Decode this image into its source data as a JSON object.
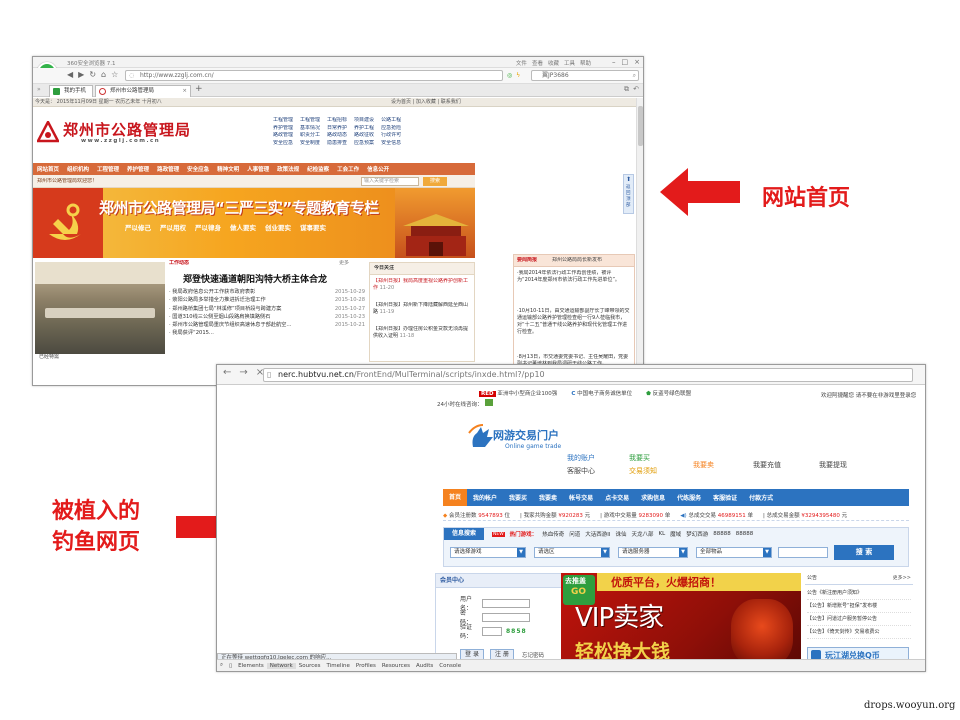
{
  "w1": {
    "title": "360安全浏览器 7.1",
    "menu_right": [
      "文件",
      "查看",
      "收藏",
      "工具",
      "帮助"
    ],
    "url": "http://www.zzglj.com.cn/",
    "search_text": "翼JP3686",
    "tabs": [
      "我的手机",
      "郑州市公路管理局"
    ],
    "tab_add": "+",
    "strip_left": "今天是： 2015年11月09日  星期一  农历乙未年  十月初八",
    "strip_right": "设为首页 | 加入收藏 | 联系我们",
    "site_name": "郑州市公路管理局",
    "site_domain": "www.zzglj.com.cn",
    "quick_links": [
      [
        "工程管理",
        "工程管理",
        "工程招标",
        "项目建设",
        "公路工程"
      ],
      [
        "养护管理",
        "基本情况",
        "日常养护",
        "养护工程",
        "应急抢险"
      ],
      [
        "路政管理",
        "职责分工",
        "路政动态",
        "路政征收",
        "行政许可"
      ],
      [
        "安全应急",
        "安全制度",
        "隐患排查",
        "应急预案",
        "安全信息"
      ]
    ],
    "nav": [
      "网站首页",
      "组织机构",
      "工程管理",
      "养护管理",
      "路政管理",
      "安全应急",
      "精神文明",
      "人事管理",
      "政策法规",
      "纪检监察",
      "工会工作",
      "信息公开"
    ],
    "welcome": "郑州市公路管理局欢迎您！",
    "search_placeholder": "输入关键字检索",
    "search_btn": "搜索",
    "banner_title": "郑州市公路管理局“三严三实”专题教育专栏",
    "banner_sub": [
      "严以修己",
      "严以用权",
      "严以律身",
      "做人要实",
      "创业要实",
      "谋事要实"
    ],
    "work_label": "工作动态",
    "more": "更多",
    "headline": "郑登快速通道朝阳沟特大桥主体合龙",
    "news": [
      [
        "· 我局政府信息公开工作获市政府表彰",
        "2015-10-29"
      ],
      [
        "· 荥阳公路局多举措全力推进拆迁治理工作",
        "2015-10-28"
      ],
      [
        "· 郑州路桥集团七局“林溪修”项目桥段与跨建方案",
        "2015-10-27"
      ],
      [
        "· 国道310线三公侧至烟山段路肩换填路侧石",
        "2015-10-23"
      ],
      [
        "· 郑州市公路管理局重庆节组织高速休息于部赴航空...",
        "2015-10-21"
      ],
      [
        "· 我局获评“2015...",
        ""
      ]
    ],
    "mid_title": "今日关注",
    "mid_items": [
      [
        "【郑州日报】我局高度重视公路养护创新工作",
        "11-20"
      ],
      [
        "【郑州日报】郑州新下降陆藏解西延至西山路",
        "11-19"
      ],
      [
        "【郑州日报】办理住房公积金贷款无须再提供收入证明",
        "11-18"
      ]
    ],
    "right_title": "要闻简报",
    "right_sub": "郑州公路局局长新发布",
    "right_items": [
      "·我局2014年依法行政工作再创佳绩，被评为“2014年度郑州市依法行政工作先进单位”。",
      "·10月10-11日，由交通运输部副厅长丁峰带领的交通运输部公路养护管理检查组一行9人莅临我市，对“十二五”普通干线公路养护和现代化管理工作进行检查。",
      "·8月13日，市交通委党委书记、主任吴耀田，党委副书记董培林到我局调研干线公路工作。"
    ],
    "float_label": "返回顶部",
    "photo_tag": "已经特需"
  },
  "callout_top": "网站首页",
  "callout_left_1": "被植入的",
  "callout_left_2": "钓鱼网页",
  "footer_credit": "drops.wooyun.org",
  "w2": {
    "url_domain": "nerc.hubtvu.net.cn",
    "url_path": "/FrontEnd/MulTerminal/scripts/inxde.html?/pp10",
    "top_items": [
      "亚洲中小型商企业100强",
      "中国电子商务诚信单位",
      "反盗号绿色联盟"
    ],
    "top_right": "欢迎阿捷醒您 请不要在非游戏里登录您",
    "support": "24小时在线咨询：",
    "logo_main": "网游交易门户",
    "logo_sub": "Online game trade",
    "header_links": [
      [
        "我的账户",
        "客服中心"
      ],
      [
        "我要买",
        "交易须知"
      ],
      [
        "我要卖",
        ""
      ],
      [
        "我要充值",
        ""
      ],
      [
        "我要提现",
        ""
      ]
    ],
    "nav": [
      "首页",
      "我的帐户",
      "我要买",
      "我要卖",
      "帐号交易",
      "点卡交易",
      "求购信息",
      "代练服务",
      "客服验证",
      "付款方式"
    ],
    "stats": [
      [
        "会员注册数",
        "9547893",
        "位"
      ],
      [
        "我家共购金额",
        "¥920283",
        "元"
      ],
      [
        "游戏中交易量",
        "9283090",
        "单"
      ],
      [
        "总成交交易",
        "46989151",
        "单"
      ],
      [
        "总成交易金额",
        "¥3294395480",
        "元"
      ]
    ],
    "search_tab": "信息搜索",
    "hot_label": "热门游戏：",
    "hot_games": [
      "热血传奇",
      "问道",
      "大话西游II",
      "诛仙",
      "天龙八部",
      "KL",
      "魔域",
      "梦幻西游",
      "88888",
      "88888"
    ],
    "selects": [
      "请选择游戏",
      "请选区",
      "请选服务器",
      "全部物品"
    ],
    "search_btn": "搜 索",
    "member_title": "会员中心",
    "user_label": "用户名：",
    "pass_label": "密　码：",
    "code_label": "验证码：",
    "code_value": "8858",
    "login_btn": "登 录",
    "reg_btn": "注 册",
    "forgot": "忘记密码",
    "ad_top": "优质平台，火爆招商！",
    "ad_badge_1": "去推盖",
    "ad_badge_2": "GO",
    "ad_big": "VIP卖家",
    "ad_bottom": "轻松挣大钱",
    "notice_title": "公告",
    "notice_more": "更多>>",
    "notices": [
      "公告《新注册用户须知》",
      "【公告】新增账号“担保”发布楼",
      "【公告】问道过户服务暂停公告",
      "【公告】《倚天剑传》交易收费公"
    ],
    "promo": "玩江湖兑换Q币",
    "status": "正在等待 wettggfg10.lqelec.com 的响应...",
    "devtools": [
      "Elements",
      "Network",
      "Sources",
      "Timeline",
      "Profiles",
      "Resources",
      "Audits",
      "Console"
    ]
  },
  "colors": {
    "accent_red": "#e31b1b",
    "site_orange": "#d76a3a",
    "portal_blue": "#2c73c0"
  }
}
